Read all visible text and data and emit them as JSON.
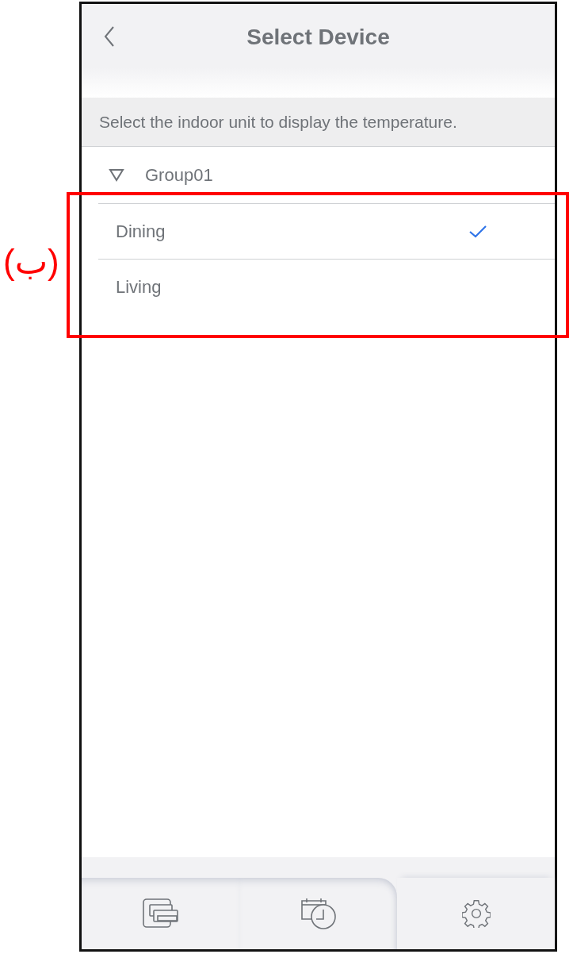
{
  "header": {
    "title": "Select Device"
  },
  "hint": "Select the indoor unit to display the temperature.",
  "groups": [
    {
      "name": "Group01",
      "expanded": true,
      "children": [
        {
          "name": "Dining",
          "selected": true
        },
        {
          "name": "Living",
          "selected": false
        }
      ]
    }
  ],
  "nav": [
    {
      "kind": "units",
      "selected": false
    },
    {
      "kind": "schedule",
      "selected": false
    },
    {
      "kind": "settings",
      "selected": true
    }
  ],
  "annotation": {
    "label": "(ب)"
  }
}
